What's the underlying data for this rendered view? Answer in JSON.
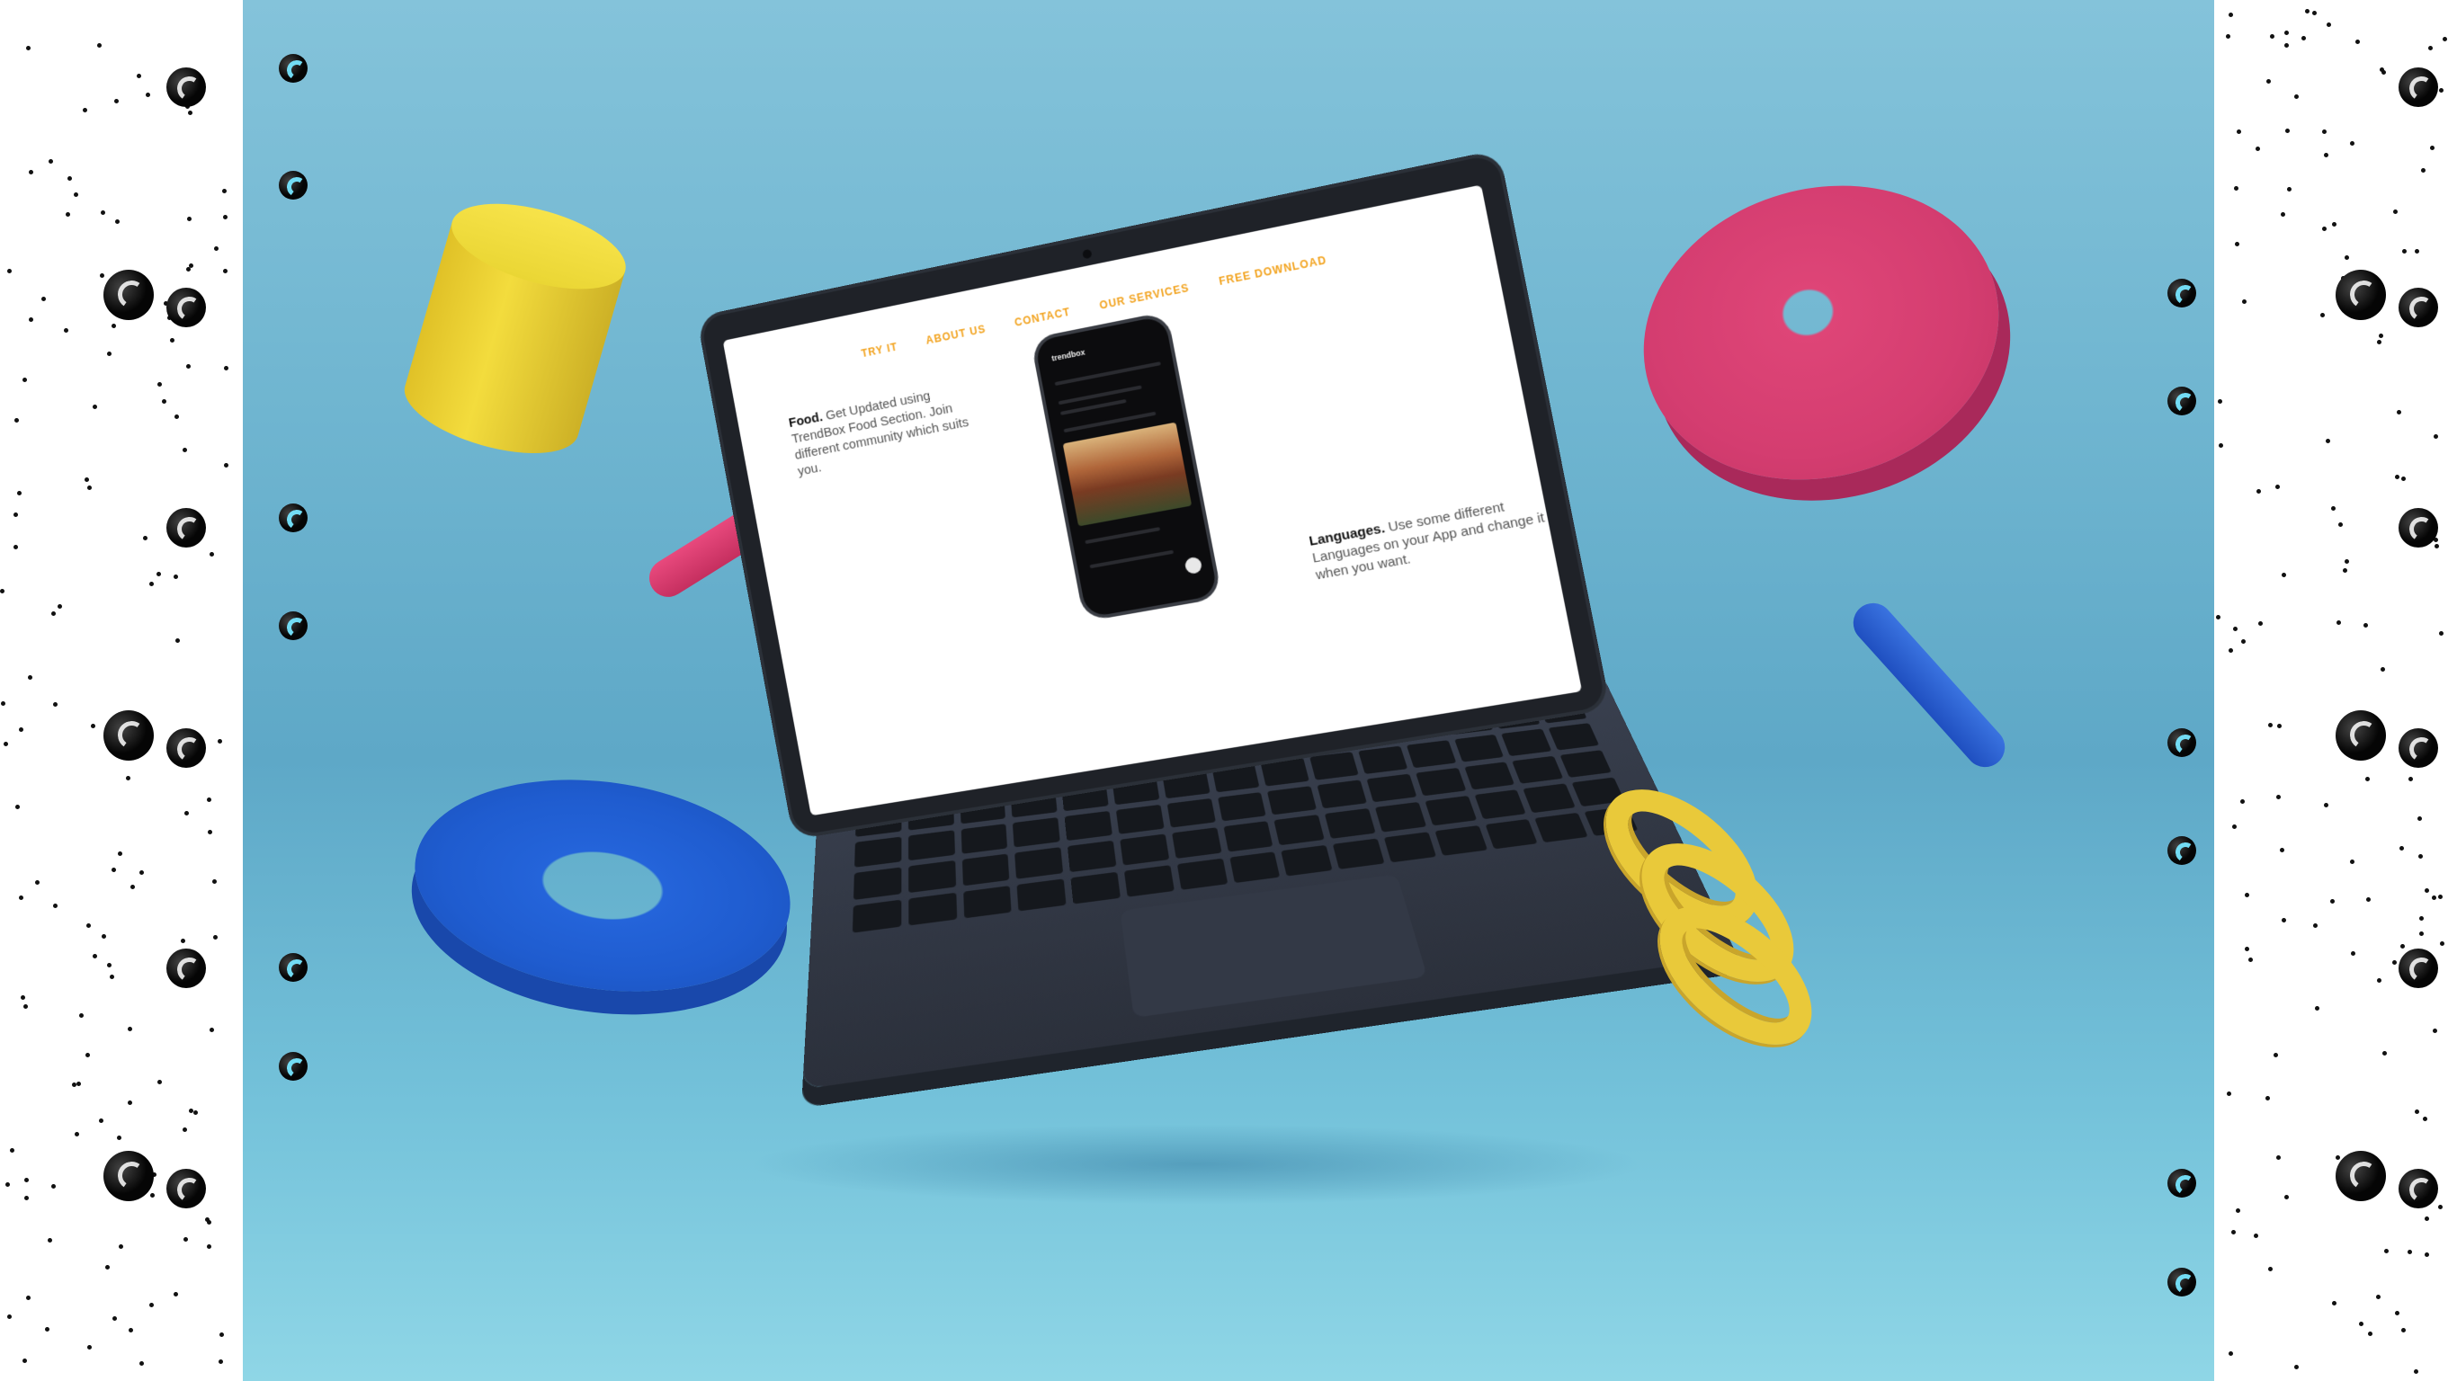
{
  "website": {
    "nav": [
      "TRY IT",
      "ABOUT US",
      "CONTACT",
      "OUR SERVICES",
      "FREE DOWNLOAD"
    ],
    "feature_food": {
      "title": "Food.",
      "text": "Get Updated using TrendBox Food Section. Join different community which suits you."
    },
    "feature_language": {
      "title": "Languages.",
      "text": "Use some different Languages on your App and change it when you want."
    },
    "phone_app_name": "trendbox"
  },
  "colors": {
    "stage_blue": "#6fb5d0",
    "accent_orange": "#f2a21c",
    "shape_yellow": "#f3dc3d",
    "shape_pink": "#de4577",
    "shape_blue": "#2464da"
  }
}
